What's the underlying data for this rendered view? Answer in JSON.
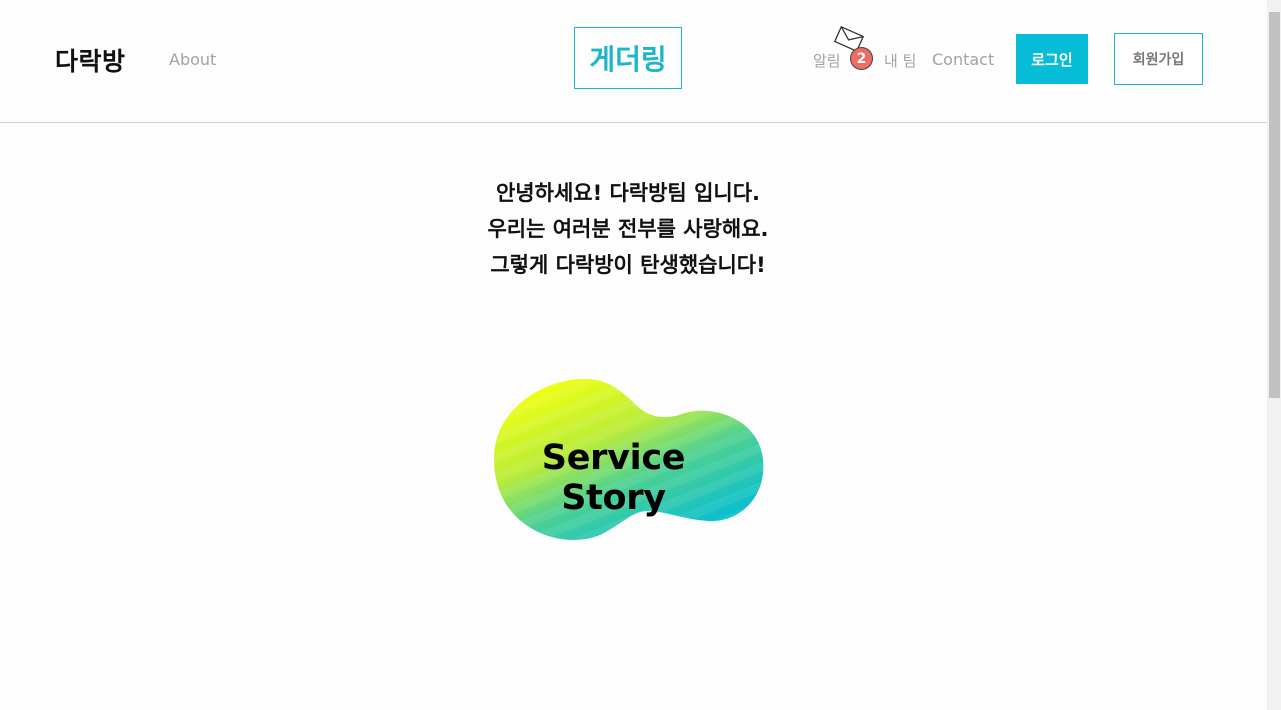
{
  "header": {
    "brand": "다락방",
    "nav_about": "About",
    "center_logo": "게더링",
    "nav_alarm": "알림",
    "alarm_count": "2",
    "nav_team": "내 팀",
    "nav_contact": "Contact",
    "login_label": "로그인",
    "signup_label": "회원가입"
  },
  "main": {
    "intro_lines": [
      "안녕하세요! 다락방팀 입니다.",
      "우리는 여러분 전부를 사랑해요.",
      "그렇게 다락방이 탄생했습니다!"
    ],
    "service_story_label": "Service Story"
  },
  "colors": {
    "accent": "#07bcd6",
    "badge": "#f06b62",
    "gradient_start": "#f0ff10",
    "gradient_end": "#00bcd6"
  },
  "icons": {
    "alarm": "envelope-icon"
  }
}
